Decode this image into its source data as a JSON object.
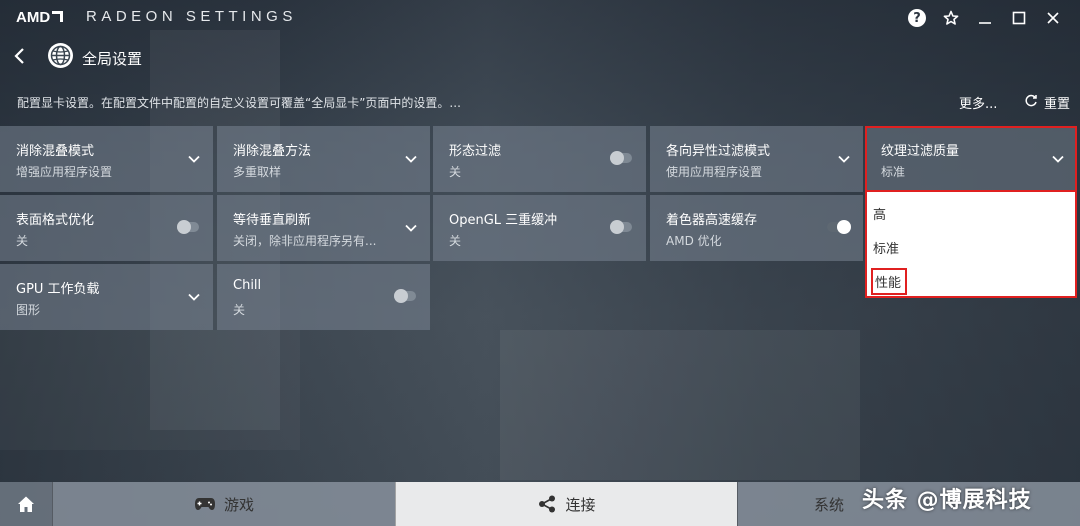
{
  "window": {
    "brand": "AMD",
    "title": "RADEON SETTINGS"
  },
  "header": {
    "page_title": "全局设置",
    "description": "配置显卡设置。在配置文件中配置的自定义设置可覆盖“全局显卡”页面中的设置。...",
    "more_label": "更多...",
    "reset_label": "重置"
  },
  "tiles": [
    {
      "title": "消除混叠模式",
      "value": "增强应用程序设置",
      "control": "dropdown"
    },
    {
      "title": "消除混叠方法",
      "value": "多重取样",
      "control": "dropdown"
    },
    {
      "title": "形态过滤",
      "value": "关",
      "control": "toggle",
      "on": false
    },
    {
      "title": "各向异性过滤模式",
      "value": "使用应用程序设置",
      "control": "dropdown"
    },
    {
      "title": "纹理过滤质量",
      "value": "标准",
      "control": "dropdown"
    },
    {
      "title": "表面格式优化",
      "value": "关",
      "control": "toggle",
      "on": false
    },
    {
      "title": "等待垂直刷新",
      "value": "关闭，除非应用程序另有...",
      "control": "dropdown"
    },
    {
      "title": "OpenGL 三重缓冲",
      "value": "关",
      "control": "toggle",
      "on": false
    },
    {
      "title": "着色器高速缓存",
      "value": "AMD 优化",
      "control": "toggle",
      "on": true
    },
    {
      "title": "GPU 工作负载",
      "value": "图形",
      "control": "dropdown"
    },
    {
      "title": "Chill",
      "value": "关",
      "control": "toggle",
      "on": false
    }
  ],
  "dropdown": {
    "options": [
      "高",
      "标准",
      "性能"
    ],
    "highlighted": "性能"
  },
  "bottom_nav": {
    "games_label": "游戏",
    "connect_label": "连接",
    "system_label": "系统"
  },
  "watermark": "头条 @博展科技",
  "colors": {
    "highlight_border": "#e02020",
    "active_tab_bg": "#e9eaeb"
  },
  "icons": [
    "help-icon",
    "star-icon",
    "minimize-icon",
    "maximize-icon",
    "close-icon",
    "back-icon",
    "globe-icon",
    "reset-icon",
    "chevron-down-icon",
    "home-icon",
    "gamepad-icon",
    "share-icon"
  ]
}
